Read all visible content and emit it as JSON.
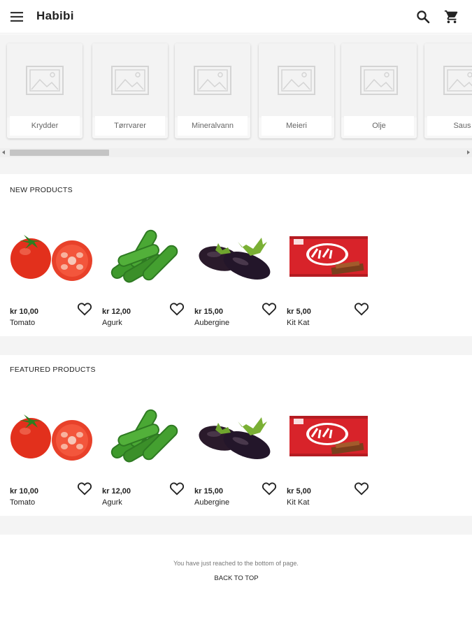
{
  "app": {
    "title": "Habibi"
  },
  "icons": {
    "menu": "menu-icon",
    "search": "search-icon",
    "cart": "cart-icon",
    "favorite": "heart-outline-icon",
    "placeholder": "image-placeholder-icon"
  },
  "categories": [
    {
      "label": "Krydder"
    },
    {
      "label": "Tørrvarer"
    },
    {
      "label": "Mineralvann"
    },
    {
      "label": "Meieri"
    },
    {
      "label": "Olje"
    },
    {
      "label": "Saus"
    }
  ],
  "new_products": {
    "title": "NEW PRODUCTS",
    "items": [
      {
        "price": "kr 10,00",
        "name": "Tomato"
      },
      {
        "price": "kr 12,00",
        "name": "Agurk"
      },
      {
        "price": "kr 15,00",
        "name": "Aubergine"
      },
      {
        "price": "kr 5,00",
        "name": "Kit Kat"
      }
    ]
  },
  "featured_products": {
    "title": "FEATURED PRODUCTS",
    "items": [
      {
        "price": "kr 10,00",
        "name": "Tomato"
      },
      {
        "price": "kr 12,00",
        "name": "Agurk"
      },
      {
        "price": "kr 15,00",
        "name": "Aubergine"
      },
      {
        "price": "kr 5,00",
        "name": "Kit Kat"
      }
    ]
  },
  "footer": {
    "message": "You have just reached to the bottom of page.",
    "back_to_top": "BACK TO TOP"
  },
  "colors": {
    "section_gap": "#f4f4f4",
    "kitkat_red": "#d8232a",
    "tomato": "#e8321e",
    "cucumber": "#3f8f2a",
    "eggplant": "#2b1a2e"
  }
}
